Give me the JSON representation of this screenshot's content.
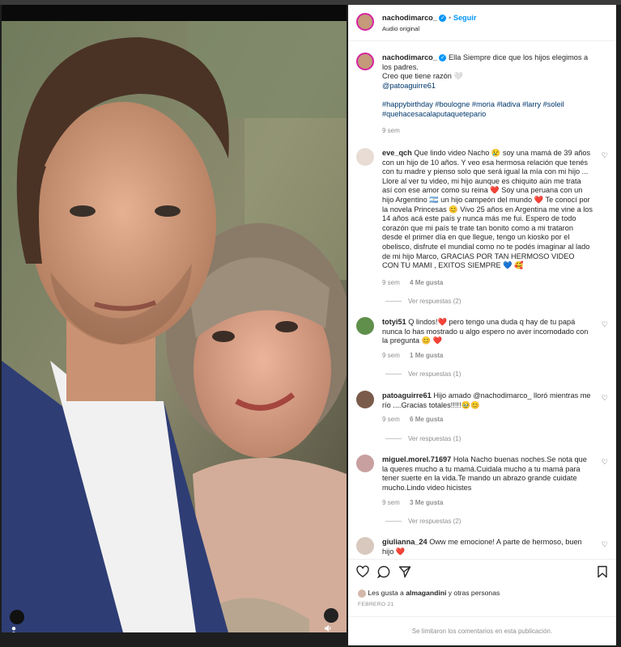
{
  "post": {
    "username": "nachodimarco_",
    "follow_label": "Seguir",
    "audio": "Audio original",
    "caption_line1": "Ella Siempre dice que los hijos elegimos a los padres.",
    "caption_line2": "Creo que tiene razón 🤍",
    "caption_mention": "@patoaguirre61",
    "caption_tags_line1": "#happybirthday #boulogne #moria #ladiva #larry #soleil",
    "caption_tags_line2": "#quehacesacalaputaquetepario",
    "caption_time": "9 sem"
  },
  "comments": [
    {
      "user": "eve_qch",
      "text": "Que lindo video Nacho 😢 soy una mamá de 39 años con un hijo de 10 años. Y veo esa hermosa relación que tenés con tu madre y pienso solo que será igual la mía con mi hijo ... Llore al ver tu video, mi hijo aunque es chiquito aún me trata así con ese amor como su reina ❤️ Soy una peruana con un hijo Argentino 🇦🇷 un hijo campeón del mundo ❤️ Te conocí por la novela Princesas 😊 Vivo 25 años en Argentina me vine a los 14 años acá este país y nunca más me fui. Espero de todo corazón que mi país te trate tan bonito como a mi trataron desde el primer día en que llegue, tengo un kiosko por el obelisco, disfrute el mundial como no te podés imaginar al lado de mi hijo Marco, GRACIAS POR TAN HERMOSO VIDEO CON TU MAMI , EXITOS SIEMPRE 💙 🥰",
      "time": "9 sem",
      "likes": "4 Me gusta",
      "replies": "Ver respuestas (2)"
    },
    {
      "user": "totyi51",
      "text": "Q lindos!❤️ pero tengo una duda q hay de tu papá nunca lo has mostrado u algo espero no aver incomodado con la pregunta 😊 ❤️",
      "time": "9 sem",
      "likes": "1 Me gusta",
      "replies": "Ver respuestas (1)"
    },
    {
      "user": "patoaguirre61",
      "text": "Hijo amado @nachodimarco_ lloró mientras me río ....Gracias totales!!!!!🥹😊",
      "time": "9 sem",
      "likes": "6 Me gusta",
      "replies": "Ver respuestas (1)"
    },
    {
      "user": "miguel.morel.71697",
      "text": "Hola Nacho buenas noches.Se nota que la queres mucho a tu mamá.Cuidala mucho a tu mamá para tener suerte en la vida.Te mando un abrazo grande cuidate mucho.Lindo video hicistes",
      "time": "9 sem",
      "likes": "3 Me gusta",
      "replies": "Ver respuestas (2)"
    },
    {
      "user": "giulianna_24",
      "text": "Oww me emocione! A parte de hermoso, buen hijo ❤️"
    }
  ],
  "likes_text_prefix": "Les gusta a ",
  "likes_user": "almagandini",
  "likes_text_suffix": " y otras personas",
  "date": "FEBRERO 21",
  "footer": "Se limitaron los comentarios en esta publicación.",
  "icons": [
    "heart-icon",
    "comment-icon",
    "share-icon",
    "save-icon",
    "verified-icon",
    "user-tag-icon",
    "sound-icon"
  ],
  "colors": {
    "accent": "#0095f6",
    "text": "#262626",
    "muted": "#8e8e8e",
    "heart_red": "#ed4956"
  }
}
